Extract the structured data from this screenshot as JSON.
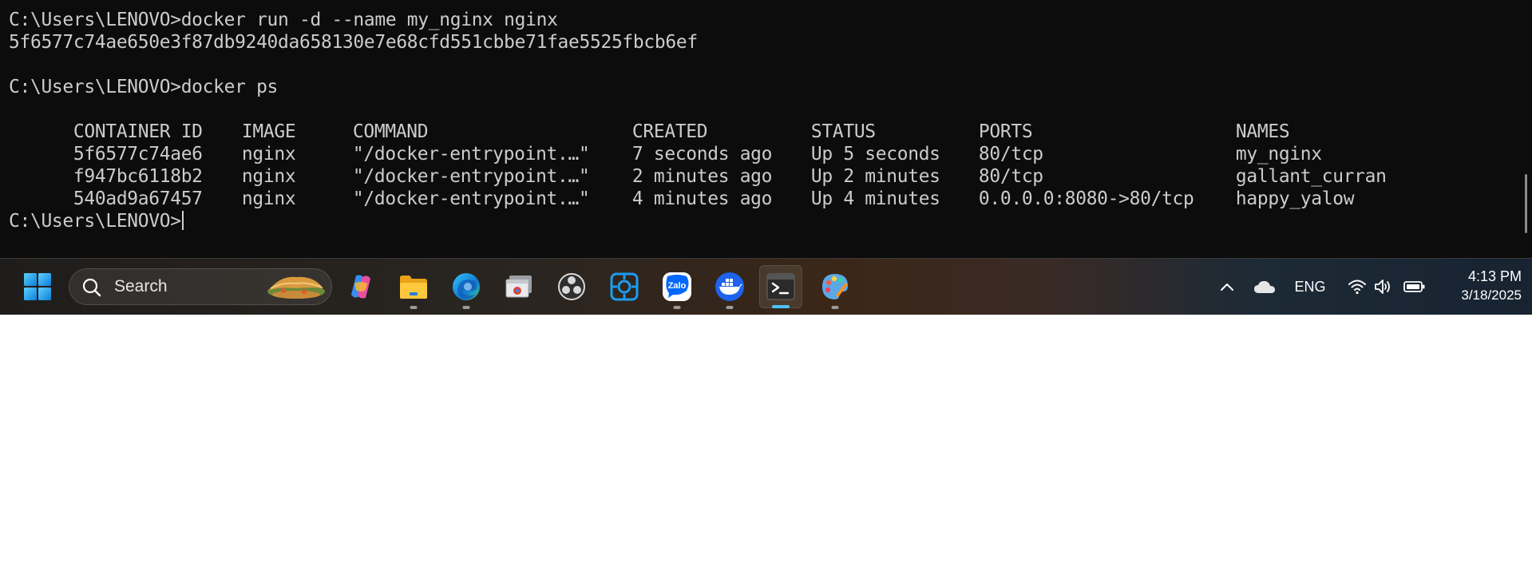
{
  "terminal": {
    "line1": "C:\\Users\\LENOVO>docker run -d --name my_nginx nginx",
    "line2": "5f6577c74ae650e3f87db9240da658130e7e68cfd551cbbe71fae5525fbcb6ef",
    "line3": "C:\\Users\\LENOVO>docker ps",
    "headers": [
      "CONTAINER ID",
      "IMAGE",
      "COMMAND",
      "CREATED",
      "STATUS",
      "PORTS",
      "NAMES"
    ],
    "rows": [
      [
        "5f6577c74ae6",
        "nginx",
        "\"/docker-entrypoint.…\"",
        "7 seconds ago",
        "Up 5 seconds",
        "80/tcp",
        "my_nginx"
      ],
      [
        "f947bc6118b2",
        "nginx",
        "\"/docker-entrypoint.…\"",
        "2 minutes ago",
        "Up 2 minutes",
        "80/tcp",
        "gallant_curran"
      ],
      [
        "540ad9a67457",
        "nginx",
        "\"/docker-entrypoint.…\"",
        "4 minutes ago",
        "Up 4 minutes",
        "0.0.0.0:8080->80/tcp",
        "happy_yalow"
      ]
    ],
    "prompt": "C:\\Users\\LENOVO>"
  },
  "taskbar": {
    "search_label": "Search",
    "apps": [
      {
        "icon": "start-windows-icon"
      },
      {
        "icon": "copilot-icon"
      },
      {
        "icon": "file-explorer-icon",
        "running": true
      },
      {
        "icon": "edge-browser-icon",
        "running": true
      },
      {
        "icon": "chrome-window-icon"
      },
      {
        "icon": "obs-studio-icon"
      },
      {
        "icon": "snipping-tool-icon"
      },
      {
        "icon": "zalo-icon",
        "running": true,
        "label": "Zalo"
      },
      {
        "icon": "docker-desktop-icon",
        "running": true
      },
      {
        "icon": "windows-terminal-icon",
        "running": true,
        "active": true
      },
      {
        "icon": "paint-icon",
        "running": true
      }
    ],
    "tray": {
      "language": "ENG",
      "time": "4:13 PM",
      "date": "3/18/2025"
    }
  },
  "colors": {
    "terminal_bg": "#0c0c0c",
    "terminal_text": "#cccccc",
    "accent": "#4cc2ff"
  }
}
